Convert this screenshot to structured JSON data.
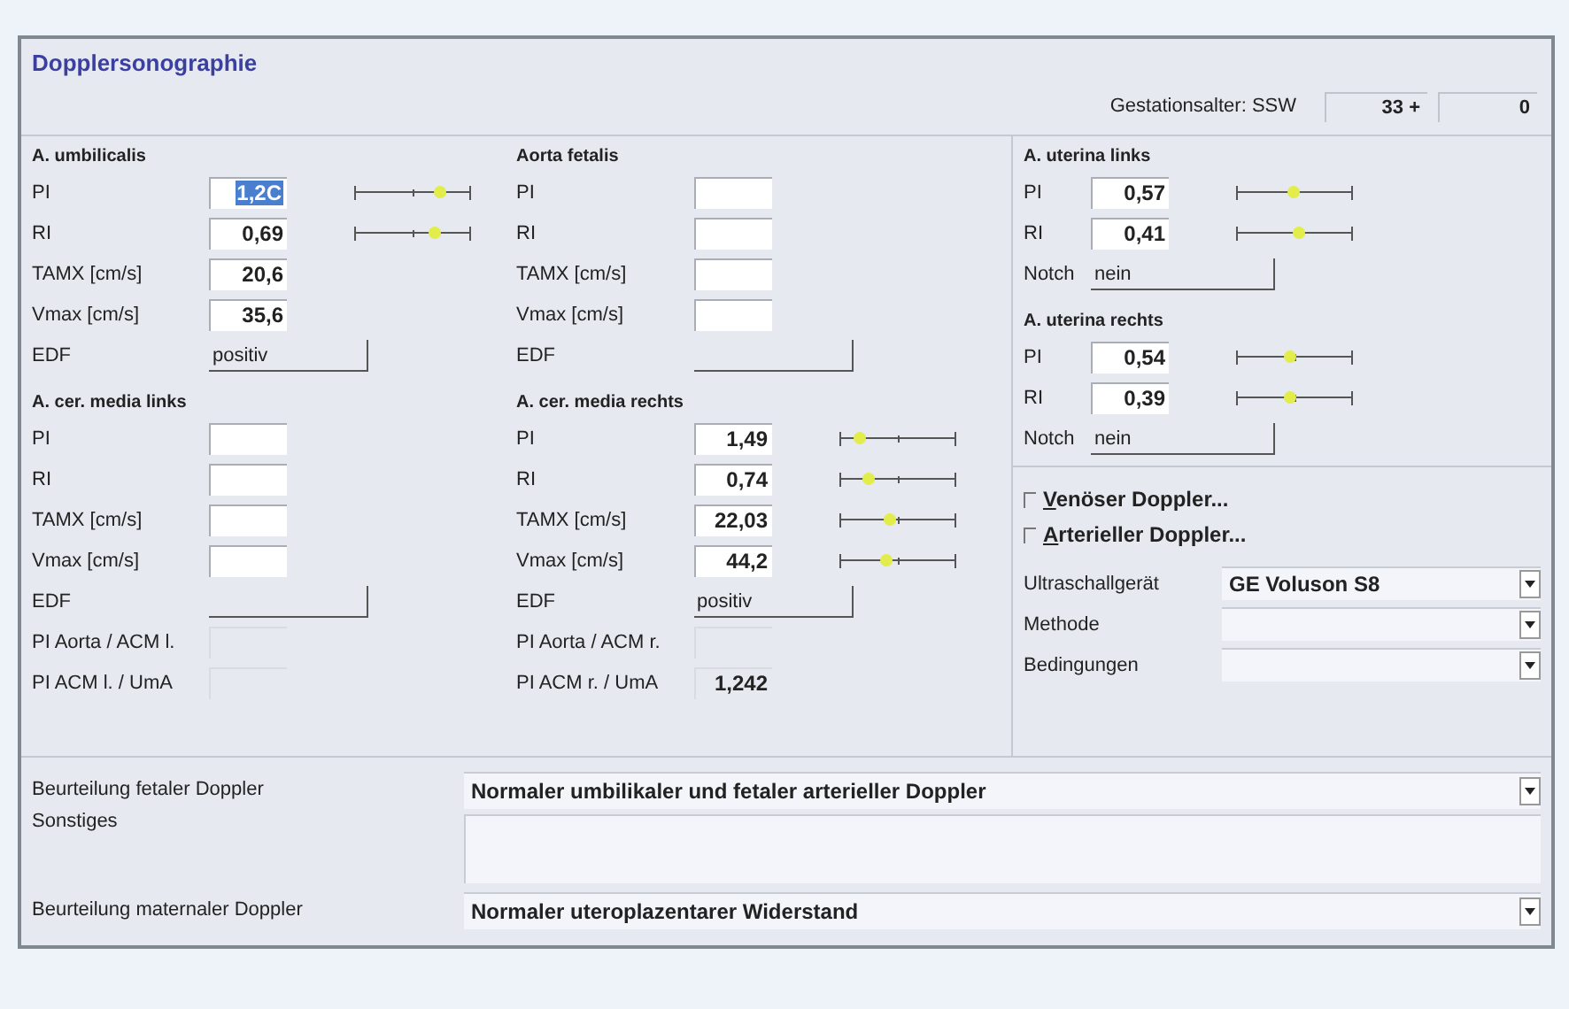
{
  "window": {
    "title": "Dopplersonographie"
  },
  "gestational_age": {
    "label": "Gestationsalter: SSW",
    "weeks": "33 +",
    "days": "0"
  },
  "fetal_columns": [
    [
      {
        "title": "A. umbilicalis",
        "rows": [
          {
            "kind": "field",
            "label": "PI",
            "value": "1,2C",
            "selected": true,
            "disabled": false,
            "level": 0.75
          },
          {
            "kind": "field",
            "label": "RI",
            "value": "0,69",
            "selected": false,
            "disabled": false,
            "level": 0.7
          },
          {
            "kind": "field",
            "label": "TAMX [cm/s]",
            "value": "20,6",
            "selected": false,
            "disabled": false
          },
          {
            "kind": "field",
            "label": "Vmax [cm/s]",
            "value": "35,6",
            "selected": false,
            "disabled": false
          },
          {
            "kind": "choice",
            "label": "EDF",
            "value": "positiv"
          }
        ]
      },
      {
        "title": "A. cer. media links",
        "rows": [
          {
            "kind": "field",
            "label": "PI",
            "disabled": false
          },
          {
            "kind": "field",
            "label": "RI",
            "disabled": false
          },
          {
            "kind": "field",
            "label": "TAMX [cm/s]",
            "disabled": false
          },
          {
            "kind": "field",
            "label": "Vmax [cm/s]",
            "disabled": false
          },
          {
            "kind": "choice",
            "label": "EDF"
          },
          {
            "kind": "field",
            "label": "PI Aorta / ACM l.",
            "disabled": true
          },
          {
            "kind": "field",
            "label": "PI ACM l. / UmA",
            "disabled": true
          }
        ]
      }
    ],
    [
      {
        "title": "Aorta fetalis",
        "rows": [
          {
            "kind": "field",
            "label": "PI",
            "disabled": false
          },
          {
            "kind": "field",
            "label": "RI",
            "disabled": false
          },
          {
            "kind": "field",
            "label": "TAMX [cm/s]",
            "disabled": false
          },
          {
            "kind": "field",
            "label": "Vmax [cm/s]",
            "disabled": false
          },
          {
            "kind": "choice",
            "label": "EDF"
          }
        ]
      },
      {
        "title": "A. cer. media rechts",
        "rows": [
          {
            "kind": "field",
            "label": "PI",
            "value": "1,49",
            "selected": false,
            "disabled": false,
            "level": 0.18
          },
          {
            "kind": "field",
            "label": "RI",
            "value": "0,74",
            "selected": false,
            "disabled": false,
            "level": 0.25
          },
          {
            "kind": "field",
            "label": "TAMX [cm/s]",
            "value": "22,03",
            "selected": false,
            "disabled": false,
            "level": 0.45
          },
          {
            "kind": "field",
            "label": "Vmax [cm/s]",
            "value": "44,2",
            "selected": false,
            "disabled": false,
            "level": 0.42
          },
          {
            "kind": "choice",
            "label": "EDF",
            "value": "positiv"
          },
          {
            "kind": "field",
            "label": "PI Aorta / ACM r.",
            "disabled": true
          },
          {
            "kind": "field",
            "label": "PI ACM r. / UmA",
            "value": "1,242",
            "selected": false,
            "disabled": true
          }
        ]
      }
    ]
  ],
  "uterine_sections": [
    {
      "title": "A. uterina links",
      "rows": [
        {
          "kind": "field",
          "label": "PI",
          "value": "0,57",
          "selected": false,
          "disabled": false,
          "level": 0.5
        },
        {
          "kind": "field",
          "label": "RI",
          "value": "0,41",
          "selected": false,
          "disabled": false,
          "level": 0.55
        },
        {
          "kind": "choice",
          "label": "Notch",
          "value": "nein"
        }
      ]
    },
    {
      "title": "A. uterina rechts",
      "rows": [
        {
          "kind": "field",
          "label": "PI",
          "value": "0,54",
          "selected": false,
          "disabled": false,
          "level": 0.47
        },
        {
          "kind": "field",
          "label": "RI",
          "value": "0,39",
          "selected": false,
          "disabled": false,
          "level": 0.47
        },
        {
          "kind": "choice",
          "label": "Notch",
          "value": "nein"
        }
      ]
    }
  ],
  "options": {
    "checkboxes": [
      {
        "label": "Venöser Doppler...",
        "checked": false
      },
      {
        "label": "Arterieller Doppler...",
        "checked": false
      }
    ],
    "selects": [
      {
        "label": "Ultraschallgerät",
        "value": "GE Voluson S8"
      },
      {
        "label": "Methode"
      },
      {
        "label": "Bedingungen"
      }
    ]
  },
  "assessment": [
    {
      "kind": "select",
      "label": "Beurteilung fetaler Doppler",
      "value": "Normaler umbilikaler und fetaler arterieller Doppler"
    },
    {
      "kind": "text",
      "label": "Sonstiges"
    },
    {
      "kind": "select",
      "label": "Beurteilung maternaler Doppler",
      "value": "Normaler uteroplazentarer Widerstand"
    }
  ]
}
